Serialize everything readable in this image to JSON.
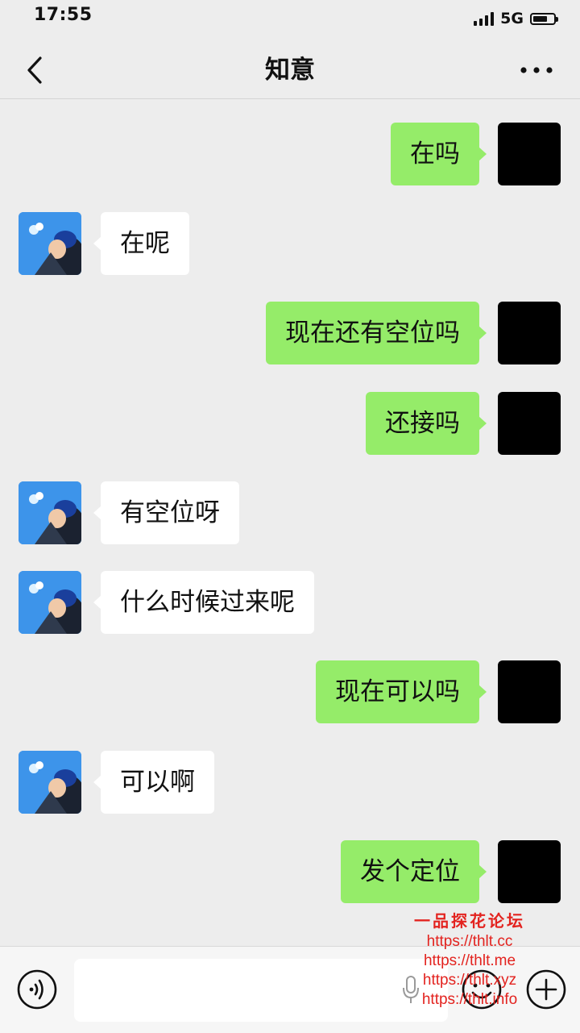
{
  "status_bar": {
    "time": "17:55",
    "network": "5G",
    "battery_level": 0.7
  },
  "nav": {
    "title": "知意",
    "back_icon": "chevron-left-icon",
    "more_icon": "more-horizontal-icon"
  },
  "messages": [
    {
      "sender": "self",
      "text": "在吗"
    },
    {
      "sender": "other",
      "text": "在呢"
    },
    {
      "sender": "self",
      "text": "现在还有空位吗"
    },
    {
      "sender": "self",
      "text": "还接吗"
    },
    {
      "sender": "other",
      "text": "有空位呀"
    },
    {
      "sender": "other",
      "text": "什么时候过来呢"
    },
    {
      "sender": "self",
      "text": "现在可以吗"
    },
    {
      "sender": "other",
      "text": "可以啊"
    },
    {
      "sender": "self",
      "text": "发个定位"
    }
  ],
  "input_bar": {
    "value": "",
    "voice_icon": "voice-icon",
    "emoji_icon": "emoji-icon",
    "plus_icon": "plus-icon"
  },
  "watermark": {
    "title": "一品探花论坛",
    "lines": [
      "https://thlt.cc",
      "https://thlt.me",
      "https://thlt.xyz",
      "https://thlt.info"
    ]
  },
  "colors": {
    "background": "#ededed",
    "self_bubble": "#95ec69",
    "other_bubble": "#ffffff",
    "watermark": "#e3231f"
  }
}
